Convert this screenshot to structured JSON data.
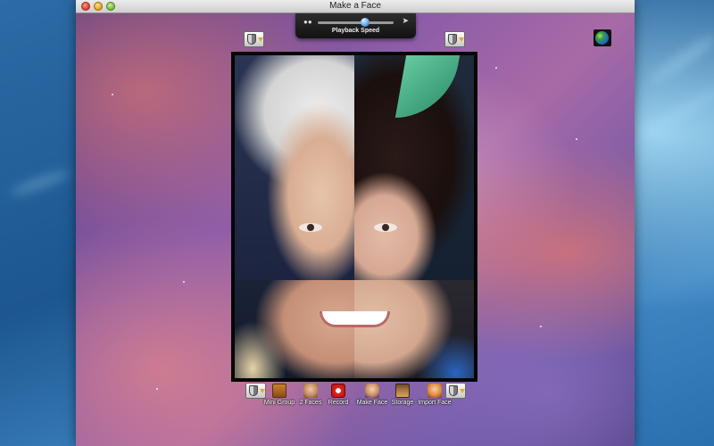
{
  "window": {
    "title": "Make a Face"
  },
  "hud": {
    "label": "Playback Speed",
    "slow_icon": "turtle-icon",
    "fast_icon": "rabbit-icon",
    "speed_fraction": 0.62
  },
  "top_controls": {
    "left_menu_icon": "shield-dropdown-icon",
    "right_menu_icon": "shield-dropdown-icon",
    "globe_icon": "globe-icon"
  },
  "toolbar": {
    "items": [
      {
        "label": "Mini Group",
        "icon": "mini-group-icon"
      },
      {
        "label": "2 Faces",
        "icon": "two-faces-icon"
      },
      {
        "label": "Record",
        "icon": "record-icon"
      },
      {
        "label": "Make Face",
        "icon": "make-face-icon"
      },
      {
        "label": "Storage",
        "icon": "storage-icon"
      },
      {
        "label": "Import Face",
        "icon": "import-face-icon"
      }
    ]
  },
  "colors": {
    "record_red": "#e0261e",
    "dropdown_arrow": "#e8a62b",
    "hud_background": "#1a1a1a"
  }
}
